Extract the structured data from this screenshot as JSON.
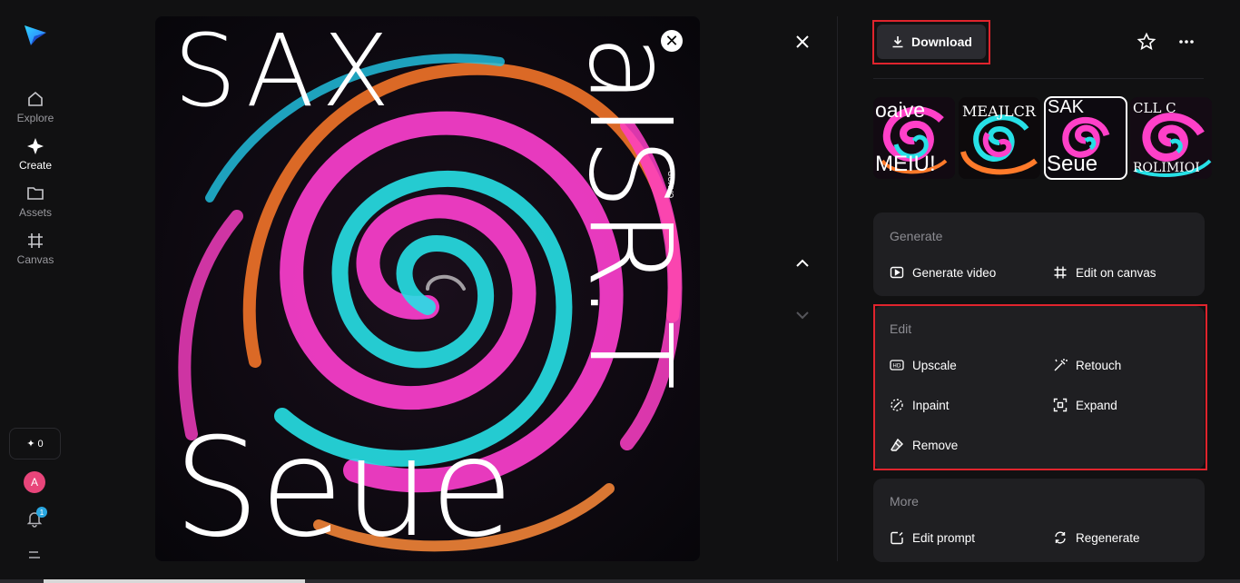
{
  "sidebar": {
    "items": [
      {
        "label": "Explore",
        "icon": "home-icon"
      },
      {
        "label": "Create",
        "icon": "sparkle-icon"
      },
      {
        "label": "Assets",
        "icon": "folder-icon"
      },
      {
        "label": "Canvas",
        "icon": "canvas-grid-icon"
      }
    ],
    "credits": "0",
    "avatar_letter": "A",
    "notification_count": "1"
  },
  "poster": {
    "headline_top": "SAX",
    "headline_right": "aISR.T",
    "headline_bottom": "Seue",
    "badge_text": "GOHVO"
  },
  "toolbar": {
    "download_label": "Download"
  },
  "thumbnails": [
    {
      "top": "oaive",
      "bottom": "MEIU!"
    },
    {
      "top": "MEAJLCR",
      "bottom": ""
    },
    {
      "top": "SAK",
      "bottom": "Seue"
    },
    {
      "top": "CLL C",
      "bottom": "ROLIMIOI"
    }
  ],
  "generate": {
    "title": "Generate",
    "generate_video": "Generate video",
    "edit_on_canvas": "Edit on canvas"
  },
  "edit": {
    "title": "Edit",
    "upscale": "Upscale",
    "retouch": "Retouch",
    "inpaint": "Inpaint",
    "expand": "Expand",
    "remove": "Remove"
  },
  "more": {
    "title": "More",
    "edit_prompt": "Edit prompt",
    "regenerate": "Regenerate"
  },
  "colors": {
    "accent_highlight": "#e0242d",
    "background": "#111112",
    "card": "#1f1f22"
  }
}
